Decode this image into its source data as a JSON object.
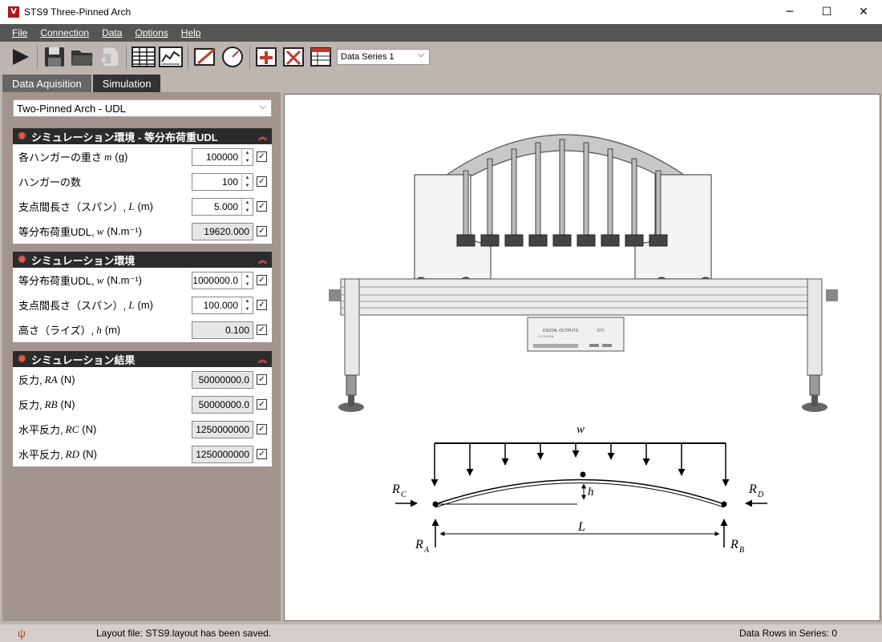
{
  "window": {
    "title": "STS9 Three-Pinned Arch",
    "icon_letter": "V",
    "minimize": "─",
    "maximize": "☐",
    "close": "✕"
  },
  "menu": [
    "File",
    "Connection",
    "Data",
    "Options",
    "Help"
  ],
  "toolbar": {
    "series_select": "Data Series 1"
  },
  "tabs": [
    "Data Aquisition",
    "Simulation"
  ],
  "simulation_select": "Two-Pinned Arch - UDL",
  "sections": [
    {
      "title": "シミュレーション環境 - 等分布荷重UDL",
      "rows": [
        {
          "label": "各ハンガーの重さ",
          "sym": "m",
          "unit": "(g)",
          "value": "100000",
          "spin": true
        },
        {
          "label": "ハンガーの数",
          "sym": "",
          "unit": "",
          "value": "100",
          "spin": true
        },
        {
          "label": "支点間長さ（スパン）,",
          "sym": "L",
          "unit": "(m)",
          "value": "5.000",
          "spin": true
        },
        {
          "label": "等分布荷重UDL,",
          "sym": "w",
          "unit": "(N.m⁻¹)",
          "value": "19620.000",
          "spin": false
        }
      ]
    },
    {
      "title": "シミュレーション環境",
      "rows": [
        {
          "label": "等分布荷重UDL,",
          "sym": "w",
          "unit": "(N.m⁻¹)",
          "value": "1000000.0",
          "spin": true
        },
        {
          "label": "支点間長さ（スパン）,",
          "sym": "L",
          "unit": "(m)",
          "value": "100.000",
          "spin": true
        },
        {
          "label": "高さ（ライズ）,",
          "sym": "h",
          "unit": "(m)",
          "value": "0.100",
          "spin": false
        }
      ]
    },
    {
      "title": "シミュレーション結果",
      "rows": [
        {
          "label": "反力,",
          "sym": "RA",
          "unit": "(N)",
          "value": "50000000.0",
          "spin": false
        },
        {
          "label": "反力,",
          "sym": "RB",
          "unit": "(N)",
          "value": "50000000.0",
          "spin": false
        },
        {
          "label": "水平反力,",
          "sym": "RC",
          "unit": "(N)",
          "value": "1250000000",
          "spin": false
        },
        {
          "label": "水平反力,",
          "sym": "RD",
          "unit": "(N)",
          "value": "1250000000",
          "spin": false
        }
      ]
    }
  ],
  "diagram": {
    "w": "w",
    "h": "h",
    "L": "L",
    "RA": "R",
    "RA_sub": "A",
    "RB": "R",
    "RB_sub": "B",
    "RC": "R",
    "RC_sub": "C",
    "RD": "R",
    "RD_sub": "D",
    "panel_text": "DIGITAL OUTPUTS",
    "panel_text2": "DTI",
    "panel_nums": "1  2  3  4  5  6"
  },
  "status": {
    "message": "Layout file: STS9.layout has been saved.",
    "rows": "Data Rows in Series: 0"
  }
}
